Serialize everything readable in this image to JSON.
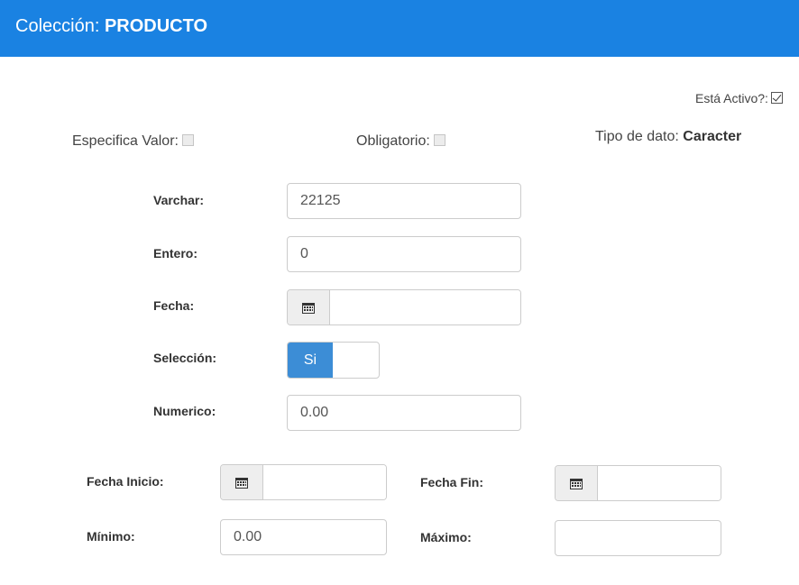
{
  "header": {
    "title_prefix": "Colección:",
    "title_name": "PRODUCTO"
  },
  "flags": {
    "active_label": "Está Activo?:",
    "active_checked": true,
    "specify_value_label": "Especifica Valor:",
    "specify_value_checked": false,
    "required_label": "Obligatorio:",
    "required_checked": false,
    "datatype_label": "Tipo de dato:",
    "datatype_value": "Caracter"
  },
  "form": {
    "varchar_label": "Varchar:",
    "varchar_value": "22125",
    "entero_label": "Entero:",
    "entero_value": "0",
    "fecha_label": "Fecha:",
    "fecha_value": "",
    "seleccion_label": "Selección:",
    "seleccion_on_label": "Si",
    "seleccion_value": true,
    "numerico_label": "Numerico:",
    "numerico_value": "0.00"
  },
  "range": {
    "fecha_inicio_label": "Fecha Inicio:",
    "fecha_inicio_value": "",
    "fecha_fin_label": "Fecha Fin:",
    "fecha_fin_value": "",
    "minimo_label": "Mínimo:",
    "minimo_value": "0.00",
    "maximo_label": "Máximo:",
    "maximo_value": ""
  },
  "icons": {
    "date_addon": "calendar-icon"
  }
}
